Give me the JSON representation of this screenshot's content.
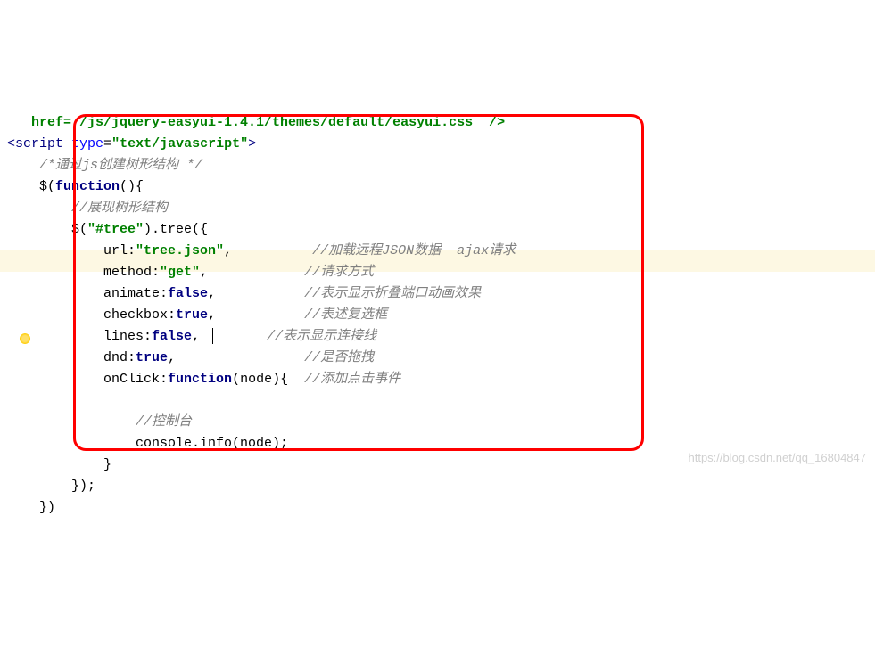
{
  "line0_partial": "   href= /js/jquery-easyui-1.4.1/themes/default/easyui.css  />",
  "line1": {
    "open": "<",
    "tag": "script ",
    "attr1": "type",
    "eq": "=",
    "val": "\"text/javascript\"",
    "close": ">"
  },
  "comment1": "/*通过js创建树形结构 */",
  "line3": "$(",
  "line3_kw": "function",
  "line3_end": "(){",
  "comment2": "//展现树形结构",
  "tree_open": "$(",
  "tree_sel": "\"#tree\"",
  "tree_open2": ").tree({",
  "prop_url_k": "url:",
  "prop_url_v": "\"tree.json\"",
  "prop_url_c": "//加载远程JSON数据  ajax请求",
  "prop_method_k": "method:",
  "prop_method_v": "\"get\"",
  "prop_method_c": "//请求方式",
  "prop_animate_k": "animate:",
  "prop_animate_v": "false",
  "prop_animate_c": "//表示显示折叠端口动画效果",
  "prop_checkbox_k": "checkbox:",
  "prop_checkbox_v": "true",
  "prop_checkbox_c": "//表述复选框",
  "prop_lines_k": "lines:",
  "prop_lines_v": "false",
  "prop_lines_c": "//表示显示连接线",
  "prop_dnd_k": "dnd:",
  "prop_dnd_v": "true",
  "prop_dnd_c": "//是否拖拽",
  "prop_onclick_k": "onClick:",
  "prop_onclick_fn": "function",
  "prop_onclick_args": "(node){",
  "prop_onclick_c": "//添加点击事件",
  "console_comment": "//控制台",
  "console_line": "console.info(node);",
  "close_brace": "}",
  "close_tree": "});",
  "close_fn": "})",
  "watermark": "https://blog.csdn.net/qq_16804847"
}
